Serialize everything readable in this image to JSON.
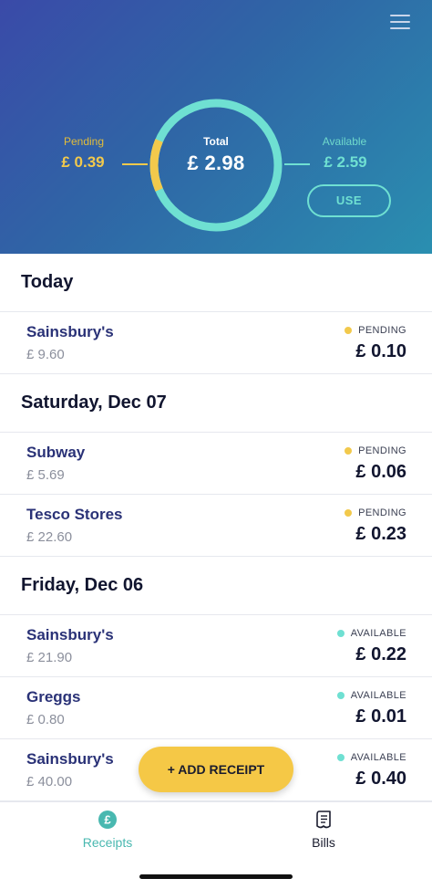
{
  "header": {
    "total_label": "Total",
    "total_value": "£ 2.98",
    "pending_label": "Pending",
    "pending_value": "£ 0.39",
    "available_label": "Available",
    "available_value": "£ 2.59",
    "use_label": "USE",
    "pending_fraction": 0.13
  },
  "colors": {
    "pending": "#f2c94c",
    "available": "#6fe0d2",
    "heading": "#11152f",
    "merchant": "#2a3277",
    "fab": "#f5c846"
  },
  "sections": [
    {
      "title": "Today",
      "rows": [
        {
          "merchant": "Sainsbury's",
          "spent": "£ 9.60",
          "status": "PENDING",
          "reward": "£ 0.10"
        }
      ]
    },
    {
      "title": "Saturday, Dec 07",
      "rows": [
        {
          "merchant": "Subway",
          "spent": "£ 5.69",
          "status": "PENDING",
          "reward": "£ 0.06"
        },
        {
          "merchant": "Tesco Stores",
          "spent": "£ 22.60",
          "status": "PENDING",
          "reward": "£ 0.23"
        }
      ]
    },
    {
      "title": "Friday, Dec 06",
      "rows": [
        {
          "merchant": "Sainsbury's",
          "spent": "£ 21.90",
          "status": "AVAILABLE",
          "reward": "£ 0.22"
        },
        {
          "merchant": "Greggs",
          "spent": "£ 0.80",
          "status": "AVAILABLE",
          "reward": "£ 0.01"
        },
        {
          "merchant": "Sainsbury's",
          "spent": "£ 40.00",
          "status": "AVAILABLE",
          "reward": "£ 0.40"
        }
      ]
    }
  ],
  "fab_label": "+ ADD RECEIPT",
  "nav": {
    "receipts_label": "Receipts",
    "receipts_icon": "pound-coin-icon",
    "bills_label": "Bills",
    "bills_icon": "bill-receipt-icon",
    "active": "receipts"
  }
}
